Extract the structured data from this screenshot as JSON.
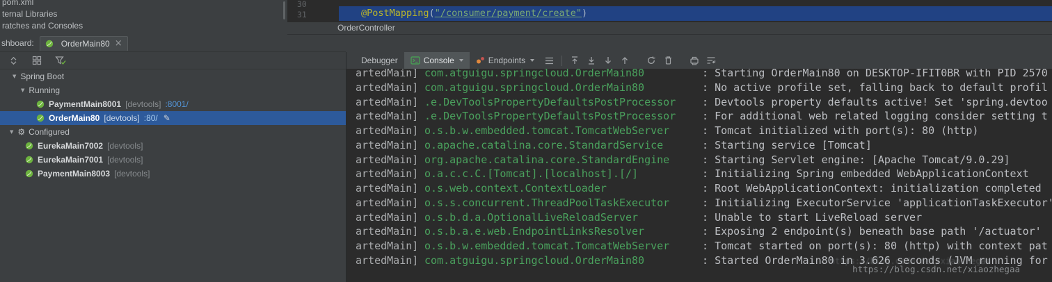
{
  "colors": {
    "panel_bg": "#3c3f41",
    "console_bg": "#2b2b2b",
    "tree_selection_blue": "#2d5a9b",
    "editor_selection_blue": "#214283",
    "link_blue": "#5394d6",
    "logger_green": "#4AA15D",
    "spring_green": "#6DB33F"
  },
  "project_tree": {
    "items": [
      "pom.xml",
      "ternal Libraries",
      "ratches and Consoles"
    ]
  },
  "editor": {
    "line_numbers": [
      "30",
      "31"
    ],
    "code": {
      "annotation": "@PostMapping",
      "open_paren": "(",
      "string_arg": "\"/consumer/payment/create\"",
      "close_paren": ")"
    },
    "tab_label": "OrderController"
  },
  "dashboard": {
    "label": "shboard:",
    "tab_title": "OrderMain80",
    "close_glyph": "×"
  },
  "console_panel": {
    "tabs": [
      {
        "label": "Debugger",
        "selected": false
      },
      {
        "label": "Console",
        "selected": true
      },
      {
        "label": "Endpoints",
        "selected": false
      }
    ]
  },
  "run_tree": {
    "rows": [
      {
        "kind": "root",
        "label": "Spring Boot"
      },
      {
        "kind": "group",
        "label": "Running"
      },
      {
        "kind": "app",
        "name": "PaymentMain8001",
        "tag": "[devtools]",
        "link": ":8001/"
      },
      {
        "kind": "app",
        "name": "OrderMain80",
        "tag": "[devtools]",
        "link": ":80/",
        "selected": true,
        "editing": true
      },
      {
        "kind": "group",
        "label": "Configured",
        "icon": "wrench"
      },
      {
        "kind": "conf",
        "name": "EurekaMain7002",
        "tag": "[devtools]"
      },
      {
        "kind": "conf",
        "name": "EurekaMain7001",
        "tag": "[devtools]"
      },
      {
        "kind": "conf",
        "name": "PaymentMain8003",
        "tag": "[devtools]"
      }
    ]
  },
  "console": {
    "separator": " : ",
    "lines": [
      {
        "thread": "artedMain]",
        "logger": "com.atguigu.springcloud.OrderMain80",
        "message": "Starting OrderMain80 on DESKTOP-IFIT0BR with PID 2570"
      },
      {
        "thread": "artedMain]",
        "logger": "com.atguigu.springcloud.OrderMain80",
        "message": "No active profile set, falling back to default profil"
      },
      {
        "thread": "artedMain]",
        "logger": ".e.DevToolsPropertyDefaultsPostProcessor",
        "message": "Devtools property defaults active! Set 'spring.devtoo"
      },
      {
        "thread": "artedMain]",
        "logger": ".e.DevToolsPropertyDefaultsPostProcessor",
        "message": "For additional web related logging consider setting t"
      },
      {
        "thread": "artedMain]",
        "logger": "o.s.b.w.embedded.tomcat.TomcatWebServer",
        "message": "Tomcat initialized with port(s): 80 (http)"
      },
      {
        "thread": "artedMain]",
        "logger": "o.apache.catalina.core.StandardService",
        "message": "Starting service [Tomcat]"
      },
      {
        "thread": "artedMain]",
        "logger": "org.apache.catalina.core.StandardEngine",
        "message": "Starting Servlet engine: [Apache Tomcat/9.0.29]"
      },
      {
        "thread": "artedMain]",
        "logger": "o.a.c.c.C.[Tomcat].[localhost].[/]",
        "message": "Initializing Spring embedded WebApplicationContext"
      },
      {
        "thread": "artedMain]",
        "logger": "o.s.web.context.ContextLoader",
        "message": "Root WebApplicationContext: initialization completed"
      },
      {
        "thread": "artedMain]",
        "logger": "o.s.s.concurrent.ThreadPoolTaskExecutor",
        "message": "Initializing ExecutorService 'applicationTaskExecutor'"
      },
      {
        "thread": "artedMain]",
        "logger": "o.s.b.d.a.OptionalLiveReloadServer",
        "message": "Unable to start LiveReload server"
      },
      {
        "thread": "artedMain]",
        "logger": "o.s.b.a.e.web.EndpointLinksResolver",
        "message": "Exposing 2 endpoint(s) beneath base path '/actuator'"
      },
      {
        "thread": "artedMain]",
        "logger": "o.s.b.w.embedded.tomcat.TomcatWebServer",
        "message": "Tomcat started on port(s): 80 (http) with context pat"
      },
      {
        "thread": "artedMain]",
        "logger": "com.atguigu.springcloud.OrderMain80",
        "message": "Started OrderMain80 in 3.626 seconds (JVM running for"
      }
    ]
  },
  "watermark": {
    "url": "https://blog.csdn.net/xiaozhegaa"
  }
}
